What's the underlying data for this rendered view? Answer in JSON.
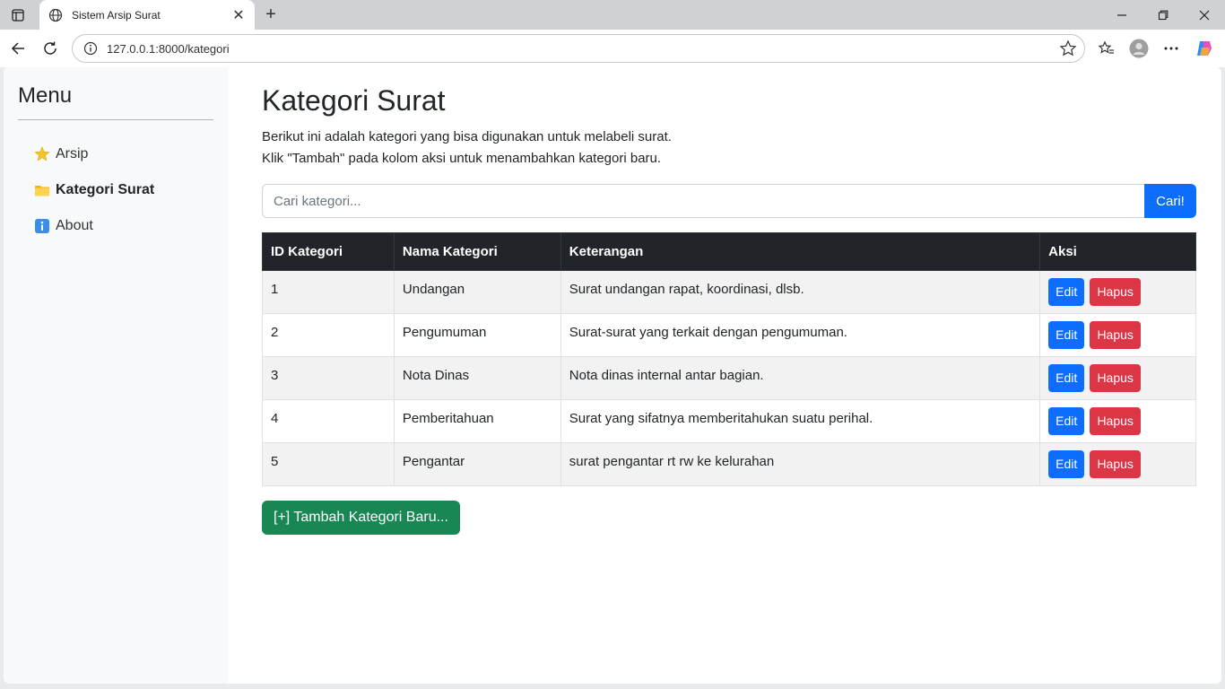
{
  "browser": {
    "tab_title": "Sistem Arsip Surat",
    "url": "127.0.0.1:8000/kategori"
  },
  "sidebar": {
    "title": "Menu",
    "items": [
      {
        "icon": "⭐",
        "label": "Arsip"
      },
      {
        "icon": "📁",
        "label": "Kategori Surat"
      },
      {
        "icon": "ℹ️",
        "label": "About"
      }
    ]
  },
  "main": {
    "title": "Kategori Surat",
    "desc_line1": "Berikut ini adalah kategori yang bisa digunakan untuk melabeli surat.",
    "desc_line2": "Klik \"Tambah\" pada kolom aksi untuk menambahkan kategori baru.",
    "search_placeholder": "Cari kategori...",
    "search_button": "Cari!",
    "add_button": "[+] Tambah Kategori Baru..."
  },
  "table": {
    "headers": [
      "ID Kategori",
      "Nama Kategori",
      "Keterangan",
      "Aksi"
    ],
    "edit_label": "Edit",
    "delete_label": "Hapus",
    "rows": [
      {
        "id": "1",
        "nama": "Undangan",
        "keterangan": "Surat undangan rapat, koordinasi, dlsb."
      },
      {
        "id": "2",
        "nama": "Pengumuman",
        "keterangan": "Surat-surat yang terkait dengan pengumuman."
      },
      {
        "id": "3",
        "nama": "Nota Dinas",
        "keterangan": "Nota dinas internal antar bagian."
      },
      {
        "id": "4",
        "nama": "Pemberitahuan",
        "keterangan": "Surat yang sifatnya memberitahukan suatu perihal."
      },
      {
        "id": "5",
        "nama": "Pengantar",
        "keterangan": "surat pengantar rt rw ke kelurahan"
      }
    ]
  }
}
